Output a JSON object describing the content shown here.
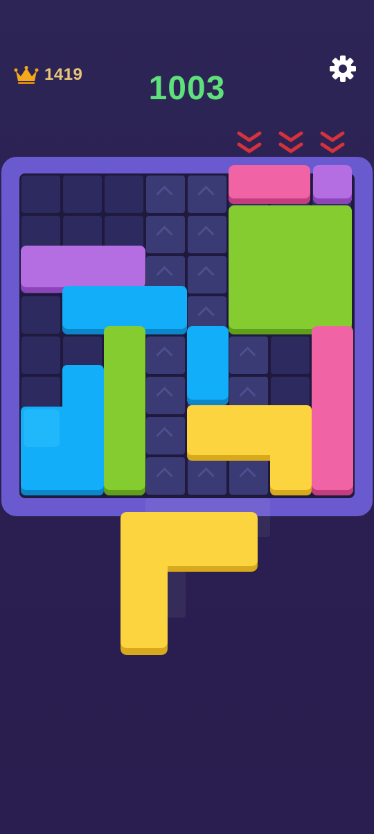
{
  "hud": {
    "best_score": "1419",
    "current_score": "1003",
    "best_icon": "crown-icon",
    "settings_icon": "gear-icon"
  },
  "incoming_columns_indicator": "chevron-double-down-icon",
  "colors": {
    "background": "#2a2050",
    "frame": "#6a5acf",
    "score": "#5ee07a",
    "best": "#e9c77a",
    "pink": "#f063a4",
    "purple": "#b56ee2",
    "green": "#84cc2f",
    "blue": "#13aefa",
    "yellow": "#fcd43f",
    "arrow": "#d6323c"
  },
  "board": {
    "columns": 8,
    "rows": 8
  },
  "pieces": [
    {
      "name": "pink-bar-top",
      "color": "pink"
    },
    {
      "name": "purple-square-top-right",
      "color": "purple"
    },
    {
      "name": "green-big-square",
      "color": "green"
    },
    {
      "name": "purple-bar-left",
      "color": "purple"
    },
    {
      "name": "blue-bar-middle",
      "color": "blue"
    },
    {
      "name": "green-vertical-bar",
      "color": "green"
    },
    {
      "name": "blue-vertical-short",
      "color": "blue"
    },
    {
      "name": "pink-vertical-right",
      "color": "pink"
    },
    {
      "name": "blue-l-piece",
      "color": "blue"
    },
    {
      "name": "yellow-l-piece-board",
      "color": "yellow"
    },
    {
      "name": "yellow-l-piece-dragging",
      "color": "yellow"
    }
  ]
}
